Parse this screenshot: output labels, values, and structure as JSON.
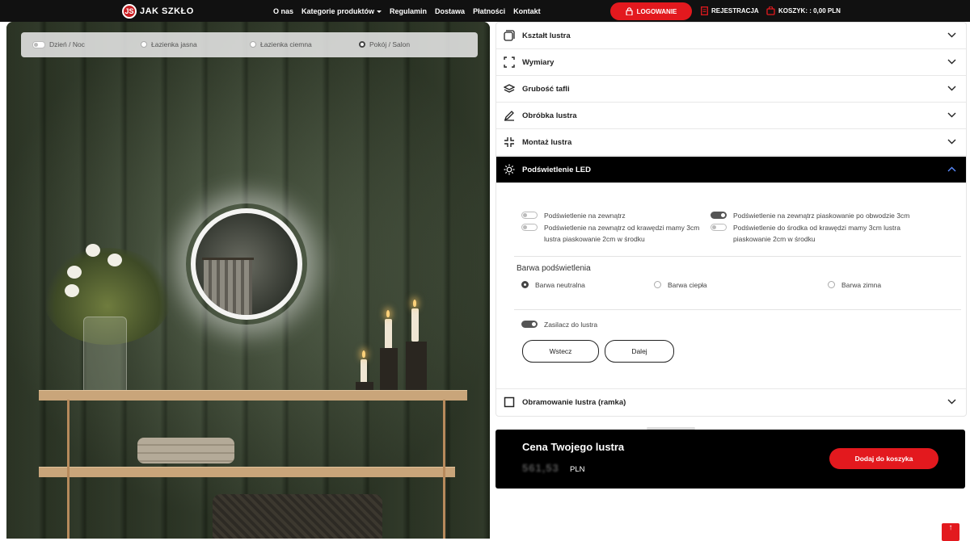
{
  "header": {
    "logo_text": "JAK SZKŁO",
    "nav": [
      "O nas",
      "Kategorie produktów",
      "Regulamin",
      "Dostawa",
      "Płatności",
      "Kontakt"
    ],
    "login_label": "LOGOWANIE",
    "register_label": "REJESTRACJA",
    "cart_label": "KOSZYK: : 0,00 PLN"
  },
  "scene": {
    "options": [
      {
        "label": "Dzień / Noc",
        "kind": "toggle",
        "selected": false
      },
      {
        "label": "Łazienka jasna",
        "kind": "radio",
        "selected": false
      },
      {
        "label": "Łazienka ciemna",
        "kind": "radio",
        "selected": false
      },
      {
        "label": "Pokój / Salon",
        "kind": "radio",
        "selected": true
      }
    ]
  },
  "configurator": {
    "sections": [
      {
        "label": "Kształt lustra",
        "icon": "shape-icon"
      },
      {
        "label": "Wymiary",
        "icon": "dimensions-icon"
      },
      {
        "label": "Grubość tafli",
        "icon": "layers-icon"
      },
      {
        "label": "Obróbka lustra",
        "icon": "pencil-icon"
      },
      {
        "label": "Montaż lustra",
        "icon": "mount-icon"
      },
      {
        "label": "Podświetlenie LED",
        "icon": "sun-icon",
        "expanded": true
      },
      {
        "label": "Obramowanie lustra (ramka)",
        "icon": "frame-icon"
      }
    ],
    "led": {
      "options": [
        {
          "label": "Podświetlenie na zewnątrz",
          "on": false
        },
        {
          "label": "Podświetlenie na zewnątrz od krawędzi mamy 3cm lustra piaskowanie 2cm w środku",
          "on": false
        },
        {
          "label": "Podświetlenie na zewnątrz piaskowanie po obwodzie 3cm",
          "on": true
        },
        {
          "label": "Podświetlenie do środka od krawędzi mamy 3cm lustra piaskowanie 2cm w środku",
          "on": false
        }
      ],
      "color_title": "Barwa podświetlenia",
      "colors": [
        {
          "label": "Barwa neutralna",
          "selected": true
        },
        {
          "label": "Barwa ciepła",
          "selected": false
        },
        {
          "label": "Barwa zimna",
          "selected": false
        }
      ],
      "power_supply": {
        "label": "Zasilacz do lustra",
        "on": true
      },
      "back_label": "Wstecz",
      "next_label": "Dalej"
    }
  },
  "price": {
    "title": "Cena Twojego lustra",
    "value": "561,53",
    "unit": "PLN",
    "add_to_cart_label": "Dodaj do koszyka"
  },
  "colors": {
    "accent": "#e3191e",
    "dark": "#000000"
  }
}
